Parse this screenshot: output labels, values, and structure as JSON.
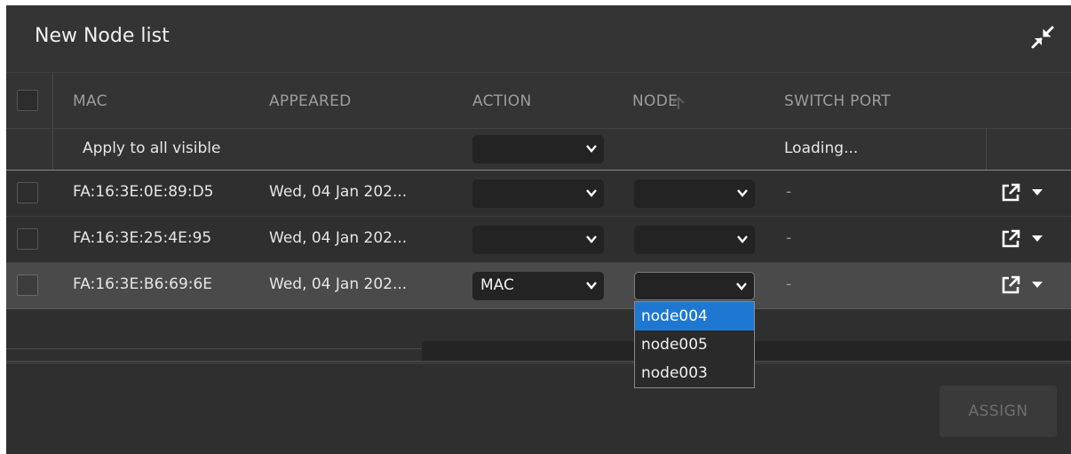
{
  "window": {
    "title": "New Node list",
    "collapse_icon": "collapse-arrows-icon"
  },
  "table": {
    "columns": [
      "MAC",
      "APPEARED",
      "ACTION",
      "NODE",
      "SWITCH PORT"
    ],
    "sort": {
      "column": "NODE",
      "direction": "ascending"
    },
    "apply_row": {
      "label": "Apply to all visible",
      "action_value": "",
      "switch_port": "Loading..."
    },
    "rows": [
      {
        "mac": "FA:16:3E:0E:89:D5",
        "appeared": "Wed, 04 Jan 202...",
        "action": "",
        "node": "",
        "switch_port": "-"
      },
      {
        "mac": "FA:16:3E:25:4E:95",
        "appeared": "Wed, 04 Jan 202...",
        "action": "",
        "node": "",
        "switch_port": "-"
      },
      {
        "mac": "FA:16:3E:B6:69:6E",
        "appeared": "Wed, 04 Jan 202...",
        "action": "MAC",
        "node": "",
        "switch_port": "-"
      }
    ]
  },
  "node_dropdown": {
    "options": [
      "node004",
      "node005",
      "node003"
    ],
    "highlighted": "node004"
  },
  "footer": {
    "assign_label": "ASSIGN"
  },
  "colors": {
    "accent": "#1e78d2",
    "panel": "#2f2f2f",
    "highlight_row": "#4a4a4a"
  }
}
